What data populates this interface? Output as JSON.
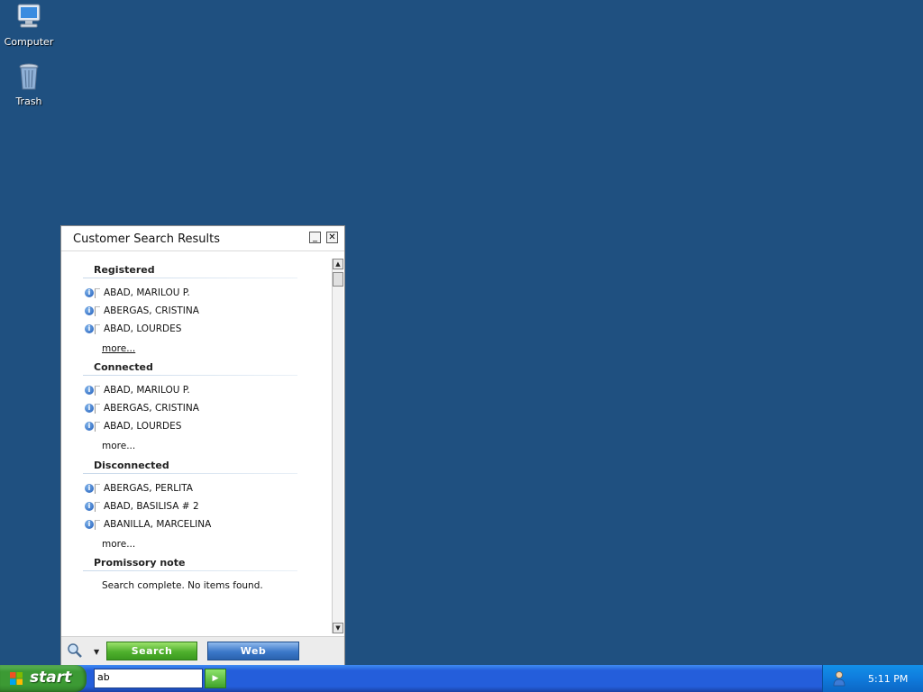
{
  "desktop": {
    "icons": [
      {
        "label": "Computer",
        "icon": "computer-icon"
      },
      {
        "label": "Trash",
        "icon": "trash-icon"
      }
    ]
  },
  "popup": {
    "title": "Customer Search Results",
    "sections": [
      {
        "title": "Registered",
        "items": [
          "ABAD, MARILOU P.",
          "ABERGAS, CRISTINA",
          "ABAD, LOURDES"
        ],
        "more": "more..."
      },
      {
        "title": "Connected",
        "items": [
          "ABAD, MARILOU P.",
          "ABERGAS, CRISTINA",
          "ABAD, LOURDES"
        ],
        "more": "more..."
      },
      {
        "title": "Disconnected",
        "items": [
          "ABERGAS, PERLITA",
          "ABAD, BASILISA # 2",
          "ABANILLA, MARCELINA"
        ],
        "more": "more..."
      },
      {
        "title": "Promissory note",
        "note": "Search complete. No items found."
      }
    ],
    "footer": {
      "search_label": "Search",
      "web_label": "Web"
    }
  },
  "taskbar": {
    "start_label": "start",
    "search_value": "ab",
    "clock": "5:11 PM"
  },
  "colors": {
    "desktop": "#1f5080",
    "taskbar": "#245edb",
    "start": "#3c9a34",
    "search_button": "#4fb02d",
    "web_button": "#3b78c9"
  }
}
